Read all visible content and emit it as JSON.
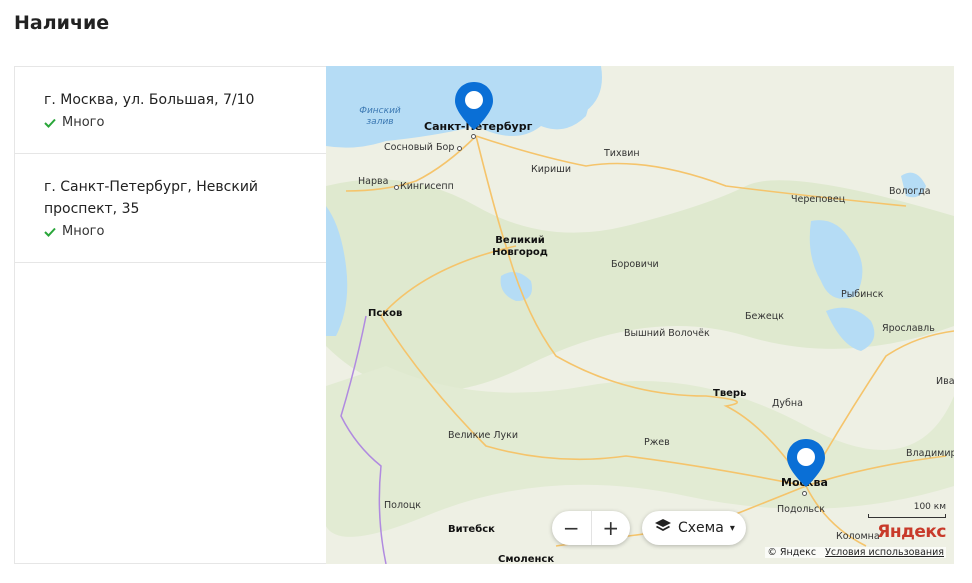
{
  "page": {
    "title": "Наличие"
  },
  "stores": [
    {
      "address": "г. Москва, ул. Большая, 7/10",
      "availability": "Много"
    },
    {
      "address": "г. Санкт-Петербург, Невский проспект, 35",
      "availability": "Много"
    }
  ],
  "map": {
    "cities": {
      "spb": "Санкт-Петербург",
      "sosnovy_bor": "Сосновый Бор",
      "narva": "Нарва",
      "kingisepp": "Кингисепп",
      "kirishi": "Кириши",
      "tikhvin": "Тихвин",
      "cherepovets": "Череповец",
      "vologda": "Вологда",
      "velikiy_novgorod": "Великий Новгород",
      "borovichi": "Боровичи",
      "rybinsk": "Рыбинск",
      "pskov": "Псков",
      "bezhetsk": "Бежецк",
      "yaroslavl": "Ярославль",
      "vyshny_volochek": "Вышний Волочёк",
      "ivanovo": "Ива",
      "tver": "Тверь",
      "dubna": "Дубна",
      "velikie_luki": "Великие Луки",
      "rzhev": "Ржев",
      "vladimir": "Владимир",
      "moscow": "Москва",
      "podolsk": "Подольск",
      "polotsk": "Полоцк",
      "vitebsk": "Витебск",
      "kolomna": "Коломна",
      "smolensk": "Смоленск"
    },
    "water": {
      "finnish_gulf": "Финский залив"
    },
    "zoom_out": "−",
    "zoom_in": "+",
    "layer_label": "Схема",
    "scale_label": "100 км",
    "logo": "Яндекс",
    "copyright": "© Яндекс",
    "terms": "Условия использования",
    "colors": {
      "pin": "#0a6fd6",
      "water": "#b5dcf5",
      "forest": "#dbe8c9",
      "road": "#f5c46b"
    }
  }
}
